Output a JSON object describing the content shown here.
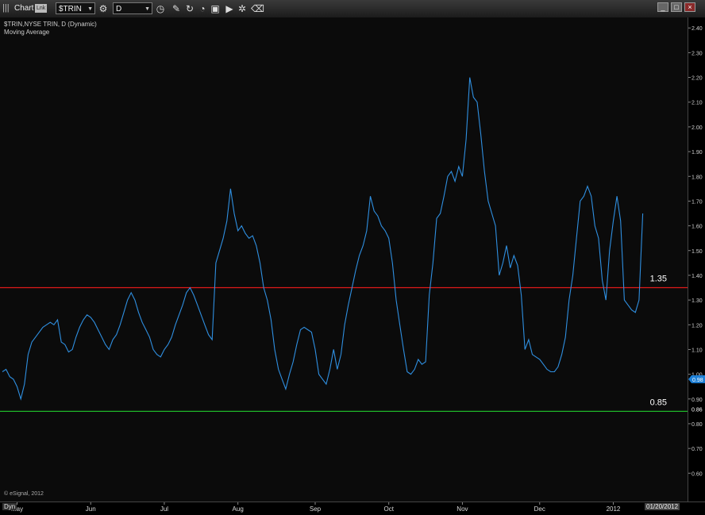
{
  "window": {
    "title": "Chart",
    "badge": "Lnk"
  },
  "toolbar": {
    "symbol": "$TRIN",
    "interval": "D",
    "tools": [
      "clock-icon",
      "pencil-icon",
      "refresh-icon",
      "gauge-icon",
      "camera-icon",
      "play-icon",
      "settings-icon",
      "eraser-icon"
    ]
  },
  "legend": {
    "line1": "$TRIN,NYSE TRIN, D (Dynamic)",
    "line2": "Moving Average"
  },
  "watermark": "© eSignal, 2012",
  "status": {
    "mode": "Dyn",
    "cursor_date": "01/20/2012"
  },
  "colors": {
    "background": "#0b0b0b",
    "series": "#2f8fe0",
    "upper_line": "#e01b1b",
    "lower_line": "#1fb82a",
    "last_value_bg": "#1d7fd6"
  },
  "chart_data": {
    "type": "line",
    "ylim": [
      0.54,
      2.42
    ],
    "ytick_values": [
      0.6,
      0.7,
      0.8,
      0.9,
      1.0,
      1.1,
      1.2,
      1.3,
      1.4,
      1.5,
      1.6,
      1.7,
      1.8,
      1.9,
      2.0,
      2.1,
      2.2,
      2.3,
      2.4
    ],
    "ytick_labels": [
      "0.60",
      "0.70",
      "0.80",
      "0.90",
      "1.00",
      "1.10",
      "1.20",
      "1.30",
      "1.40",
      "1.50",
      "1.60",
      "1.70",
      "1.80",
      "1.90",
      "2.00",
      "2.10",
      "2.20",
      "2.30",
      "2.40"
    ],
    "x_labels": [
      "May",
      "Jun",
      "Jul",
      "Aug",
      "Sep",
      "Oct",
      "Nov",
      "Dec",
      "2012"
    ],
    "x_label_positions": [
      4,
      24,
      44,
      64,
      85,
      105,
      125,
      146,
      166
    ],
    "n_bars": 182,
    "values": [
      1.01,
      1.02,
      0.99,
      0.98,
      0.95,
      0.9,
      0.96,
      1.08,
      1.13,
      1.15,
      1.17,
      1.19,
      1.2,
      1.21,
      1.2,
      1.22,
      1.13,
      1.12,
      1.09,
      1.1,
      1.15,
      1.19,
      1.22,
      1.24,
      1.23,
      1.21,
      1.18,
      1.15,
      1.12,
      1.1,
      1.14,
      1.16,
      1.2,
      1.25,
      1.3,
      1.33,
      1.3,
      1.25,
      1.21,
      1.18,
      1.15,
      1.1,
      1.08,
      1.07,
      1.1,
      1.12,
      1.15,
      1.2,
      1.24,
      1.28,
      1.33,
      1.35,
      1.32,
      1.28,
      1.24,
      1.2,
      1.16,
      1.14,
      1.45,
      1.5,
      1.55,
      1.62,
      1.75,
      1.65,
      1.58,
      1.6,
      1.57,
      1.55,
      1.56,
      1.52,
      1.45,
      1.35,
      1.3,
      1.22,
      1.1,
      1.02,
      0.98,
      0.94,
      1.0,
      1.05,
      1.12,
      1.18,
      1.19,
      1.18,
      1.17,
      1.1,
      1.0,
      0.98,
      0.96,
      1.02,
      1.1,
      1.02,
      1.08,
      1.2,
      1.28,
      1.35,
      1.42,
      1.48,
      1.52,
      1.58,
      1.72,
      1.66,
      1.64,
      1.6,
      1.58,
      1.55,
      1.45,
      1.3,
      1.2,
      1.1,
      1.01,
      1.0,
      1.02,
      1.06,
      1.04,
      1.05,
      1.32,
      1.45,
      1.63,
      1.65,
      1.72,
      1.8,
      1.82,
      1.78,
      1.84,
      1.8,
      1.95,
      2.2,
      2.12,
      2.1,
      1.97,
      1.82,
      1.7,
      1.65,
      1.6,
      1.4,
      1.45,
      1.52,
      1.43,
      1.48,
      1.44,
      1.32,
      1.1,
      1.14,
      1.08,
      1.07,
      1.06,
      1.04,
      1.02,
      1.01,
      1.01,
      1.03,
      1.08,
      1.15,
      1.3,
      1.4,
      1.55,
      1.7,
      1.72,
      1.76,
      1.72,
      1.6,
      1.55,
      1.38,
      1.3,
      1.5,
      1.62,
      1.72,
      1.62,
      1.3,
      1.28,
      1.26,
      1.25,
      1.3,
      1.65
    ]
  },
  "reference_lines": [
    {
      "value": 1.35,
      "label": "1.35"
    },
    {
      "value": 0.85,
      "label": "0.85"
    }
  ],
  "last_value": {
    "value": 0.98,
    "label": "0.98"
  },
  "level_tag": {
    "value": 0.86,
    "label": "0.86"
  }
}
